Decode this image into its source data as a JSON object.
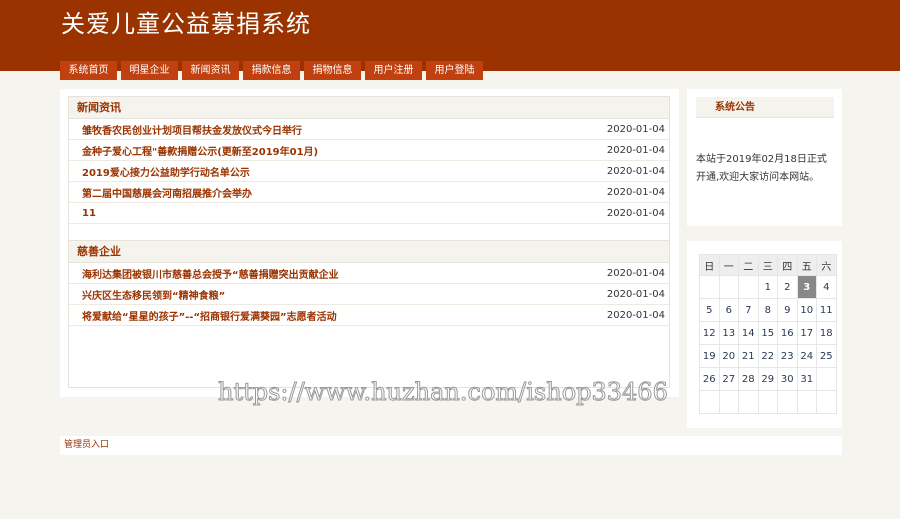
{
  "header": {
    "title": "关爱儿童公益募捐系统"
  },
  "nav": [
    "系统首页",
    "明星企业",
    "新闻资讯",
    "捐款信息",
    "捐物信息",
    "用户注册",
    "用户登陆"
  ],
  "news": {
    "title": "新闻资讯",
    "items": [
      {
        "title": "雏牧香农民创业计划项目帮扶金发放仪式今日举行",
        "date": "2020-01-04"
      },
      {
        "title": "金种子爱心工程\"善款捐赠公示(更新至2019年01月)",
        "date": "2020-01-04"
      },
      {
        "title": "2019爱心接力公益助学行动名单公示",
        "date": "2020-01-04"
      },
      {
        "title": "第二届中国慈展会河南招展推介会举办",
        "date": "2020-01-04"
      },
      {
        "title": "11",
        "date": "2020-01-04"
      }
    ]
  },
  "charity": {
    "title": "慈善企业",
    "items": [
      {
        "title": "海利达集团被银川市慈善总会授予“慈善捐赠突出贡献企业",
        "date": "2020-01-04"
      },
      {
        "title": "兴庆区生态移民领到“精神食粮”",
        "date": "2020-01-04"
      },
      {
        "title": "将爱献给“星星的孩子”--“招商银行爱满葵园”志愿者活动",
        "date": "2020-01-04"
      }
    ]
  },
  "notice": {
    "title": "系统公告",
    "text": "本站于2019年02月18日正式开通,欢迎大家访问本网站。"
  },
  "calendar": {
    "weekdays": [
      "日",
      "一",
      "二",
      "三",
      "四",
      "五",
      "六"
    ],
    "today": 3,
    "weeks": [
      [
        "",
        "",
        "",
        "1",
        "2",
        "3",
        "4"
      ],
      [
        "5",
        "6",
        "7",
        "8",
        "9",
        "10",
        "11"
      ],
      [
        "12",
        "13",
        "14",
        "15",
        "16",
        "17",
        "18"
      ],
      [
        "19",
        "20",
        "21",
        "22",
        "23",
        "24",
        "25"
      ],
      [
        "26",
        "27",
        "28",
        "29",
        "30",
        "31",
        ""
      ],
      [
        "",
        "",
        "",
        "",
        "",
        "",
        ""
      ]
    ]
  },
  "footer": {
    "admin_link": "管理员入口"
  },
  "watermark": "https://www.huzhan.com/ishop33466"
}
